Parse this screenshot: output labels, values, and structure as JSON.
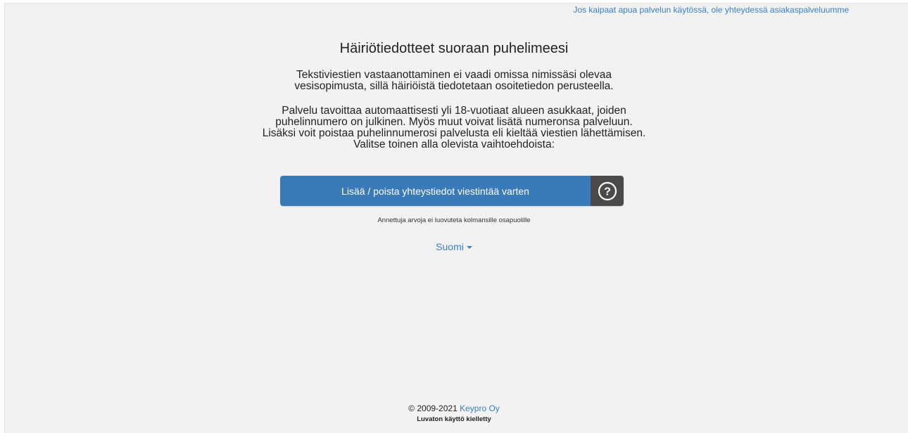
{
  "header": {
    "help_link": "Jos kaipaat apua palvelun käytössä, ole yhteydessä asiakaspalveluumme"
  },
  "main": {
    "title": "Häiriötiedotteet suoraan puhelimeesi",
    "paragraph_1": "Tekstiviestien vastaanottaminen ei vaadi omissa nimissäsi olevaa vesisopimusta, sillä häiriöistä tiedotetaan osoitetiedon perusteella.",
    "paragraph_2": "Palvelu tavoittaa automaattisesti yli 18-vuotiaat alueen asukkaat, joiden puhelinnumero on julkinen. Myös muut voivat lisätä numeronsa palveluun. Lisäksi voit poistaa puhelinnumerosi palvelusta eli kieltää viestien lähettämisen. Valitse toinen alla olevista vaihtoehdoista:",
    "action_button": "Lisää / poista yhteystiedot viestintää varten",
    "help_icon": "question-circle-icon",
    "disclaimer": "Annettuja arvoja ei luovuteta kolmansille osapuolille"
  },
  "language": {
    "selected": "Suomi"
  },
  "footer": {
    "copyright": "© 2009-2021",
    "company": "Keypro Oy",
    "notice": "Luvaton käyttö kielletty"
  },
  "colors": {
    "background": "#f2f2f2",
    "primary": "#3a7ab8",
    "link": "#3a7fc1",
    "help_button": "#4a4a4a"
  }
}
